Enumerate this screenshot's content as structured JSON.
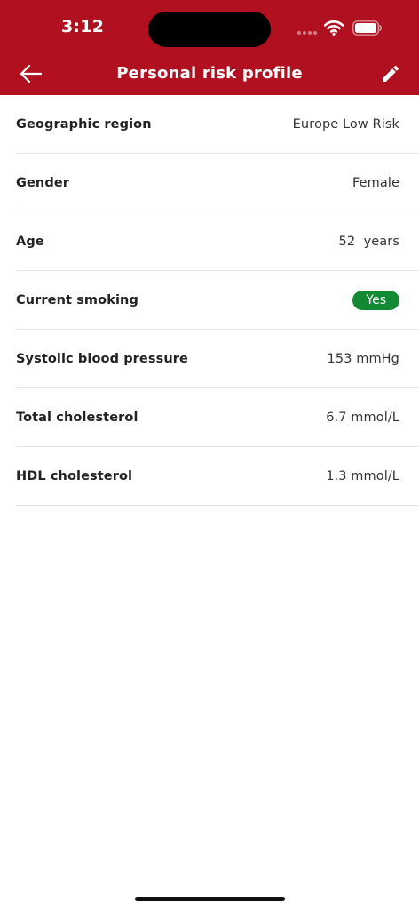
{
  "status_bar": {
    "time": "3:12"
  },
  "header": {
    "title": "Personal risk profile",
    "back_icon": "arrow-left-icon",
    "edit_icon": "pencil-icon",
    "background_color": "#b01020"
  },
  "profile": {
    "rows": [
      {
        "label": "Geographic region",
        "value": "Europe Low Risk"
      },
      {
        "label": "Gender",
        "value": "Female"
      },
      {
        "label": "Age",
        "value": "52  years"
      },
      {
        "label": "Current smoking",
        "value": "Yes",
        "badge_color": "#128a33"
      },
      {
        "label": "Systolic blood pressure",
        "value": "153 mmHg"
      },
      {
        "label": "Total cholesterol",
        "value": "6.7 mmol/L"
      },
      {
        "label": "HDL cholesterol",
        "value": "1.3 mmol/L"
      }
    ]
  }
}
